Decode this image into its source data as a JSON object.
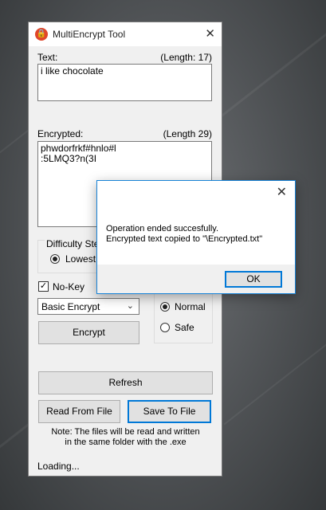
{
  "window": {
    "title": "MultiEncrypt Tool",
    "close_glyph": "✕",
    "icon": "lock-icon"
  },
  "text_section": {
    "label": "Text:",
    "length_label": "(Length: 17)",
    "value": "i like chocolate"
  },
  "encrypted_section": {
    "label": "Encrypted:",
    "length_label": "(Length 29)",
    "value": "phwdorfrkf#hnlo#l\n:5LMQ3?n(3I"
  },
  "difficulty": {
    "group_label": "Difficulty Step",
    "options": [
      {
        "label": "Lowest",
        "selected": true
      }
    ]
  },
  "no_key": {
    "label": "No-Key",
    "checked": true,
    "check_glyph": "✓"
  },
  "algorithm_select": {
    "value": "Basic Encrypt",
    "chevron": "⌄"
  },
  "mode": {
    "options": [
      {
        "label": "Normal",
        "selected": true
      },
      {
        "label": "Safe",
        "selected": false
      }
    ]
  },
  "buttons": {
    "encrypt": "Encrypt",
    "refresh": "Refresh",
    "read_from_file": "Read From File",
    "save_to_file": "Save To File"
  },
  "note": "Note: The files will be read and written\nin the same folder with the .exe",
  "status": "Loading...",
  "dialog": {
    "message_line1": "Operation ended succesfully.",
    "message_line2": "Encrypted text copied to \"\\Encrypted.txt\"",
    "ok_label": "OK",
    "close_glyph": "✕"
  },
  "colors": {
    "accent": "#0078d7",
    "window_bg": "#f0f0f0",
    "app_icon": "#e0462a"
  }
}
